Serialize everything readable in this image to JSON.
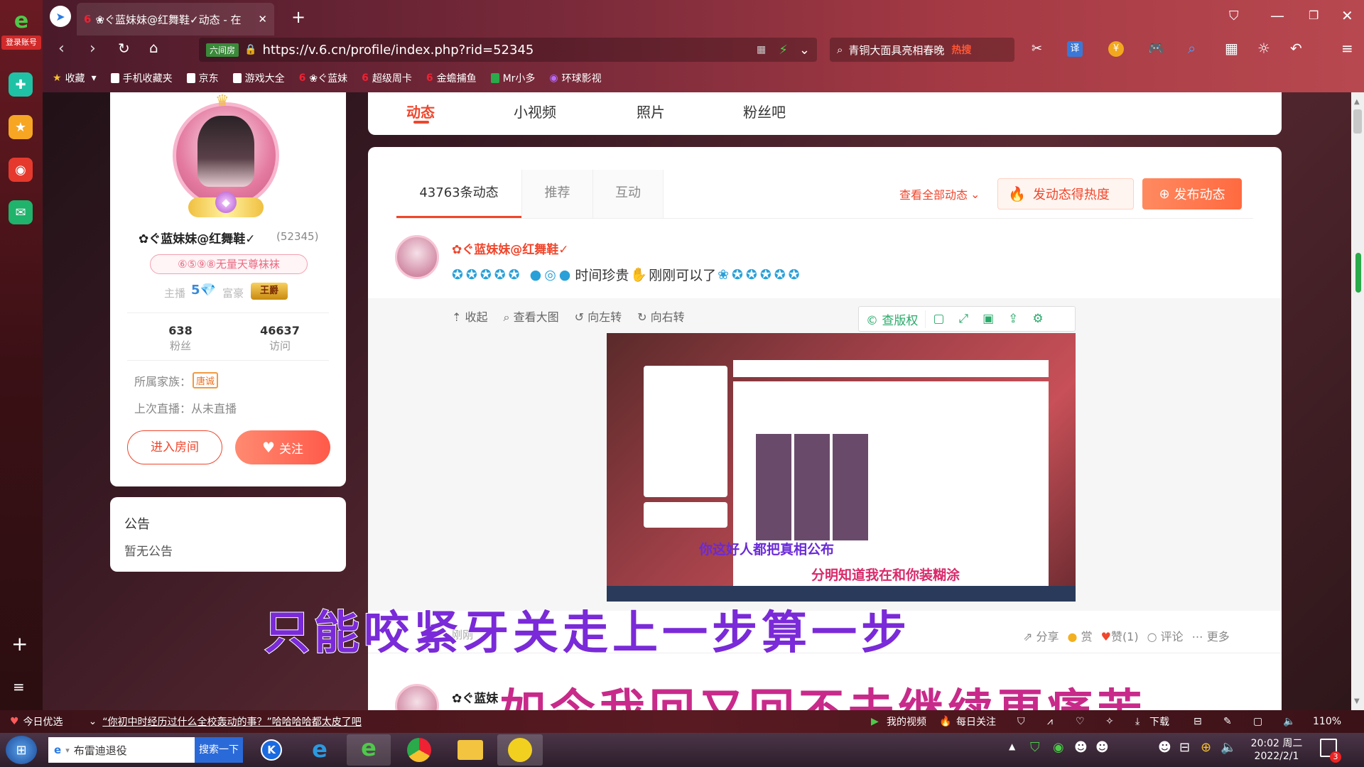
{
  "sidebar": {
    "login_label": "登录账号"
  },
  "tab": {
    "title": "❀ぐ蓝妹妹@红舞鞋✓动态 - 在"
  },
  "address": {
    "badge": "六间房",
    "url": "https://v.6.cn/profile/index.php?rid=52345"
  },
  "search": {
    "text": "青铜大面具亮相春晚",
    "hot": "热搜"
  },
  "toolbar": {
    "translate": "译"
  },
  "bookmarks": [
    "收藏",
    "手机收藏夹",
    "京东",
    "游戏大全",
    "❀ぐ蓝妹",
    "超级周卡",
    "金蟾捕鱼",
    "Mr小多",
    "环球影视"
  ],
  "nav_tabs": [
    "动态",
    "小视频",
    "照片",
    "粉丝吧"
  ],
  "profile": {
    "name": "✿ぐ蓝妹妹@红舞鞋✓",
    "rid": "(52345)",
    "badge": "⑥⑤⑨⑧无量天尊袜袜",
    "host_label": "主播",
    "rich_label": "富豪",
    "rich_level": "王爵",
    "fans_count": "638",
    "fans_label": "粉丝",
    "visits_count": "46637",
    "visits_label": "访问",
    "family_label": "所属家族：",
    "family_value": "唐诚",
    "last_live": "上次直播：从未直播",
    "enter_room": "进入房间",
    "follow": "关注"
  },
  "notice": {
    "title": "公告",
    "content": "暂无公告"
  },
  "feed": {
    "tabs": [
      "43763条动态",
      "推荐",
      "互动"
    ],
    "view_all": "查看全部动态",
    "heat": "发动态得热度",
    "publish": "发布动态",
    "post_author": "✿ぐ蓝妹妹@红舞鞋✓",
    "post_text_1": "时间珍贵",
    "post_text_2": "刚刚可以了",
    "img_tools": [
      "收起",
      "查看大图",
      "向左转",
      "向右转"
    ],
    "copyright": "查版权",
    "time": "刚刚",
    "actions": [
      "分享",
      "赏",
      "赞(1)",
      "评论",
      "更多"
    ],
    "second_author": "✿ぐ蓝妹"
  },
  "lyrics": {
    "line1": "只能咬紧牙关走上一步算一步",
    "line2": "如今我回又回不去继续更痛苦",
    "inner1": "你这好人都把真相公布",
    "inner2": "分明知道我在和你装糊涂"
  },
  "status": {
    "today": "今日优选",
    "news": "“你初中时经历过什么全校轰动的事？”哈哈哈哈都太皮了吧",
    "my_video": "我的视频",
    "daily": "每日关注",
    "download": "下载",
    "zoom": "110%"
  },
  "taskbar": {
    "ie_text": "布雷迪退役",
    "search_btn": "搜索一下",
    "time": "20:02 周二",
    "date": "2022/2/1",
    "badge": "3"
  }
}
